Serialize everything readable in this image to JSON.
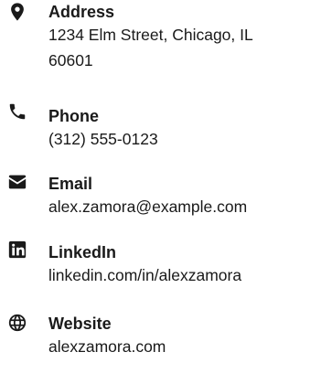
{
  "contact": {
    "items": [
      {
        "icon": "map-pin-icon",
        "label": "Address",
        "value_lines": [
          "1234 Elm Street, Chicago, IL",
          "60601"
        ]
      },
      {
        "icon": "phone-icon",
        "label": "Phone",
        "value": "(312) 555-0123"
      },
      {
        "icon": "envelope-icon",
        "label": "Email",
        "value": "alex.zamora@example.com"
      },
      {
        "icon": "linkedin-icon",
        "label": "LinkedIn",
        "value": "linkedin.com/in/alexzamora"
      },
      {
        "icon": "globe-icon",
        "label": "Website",
        "value": "alexzamora.com"
      }
    ]
  },
  "colors": {
    "text": "#1a1a1a",
    "background": "#ffffff"
  }
}
